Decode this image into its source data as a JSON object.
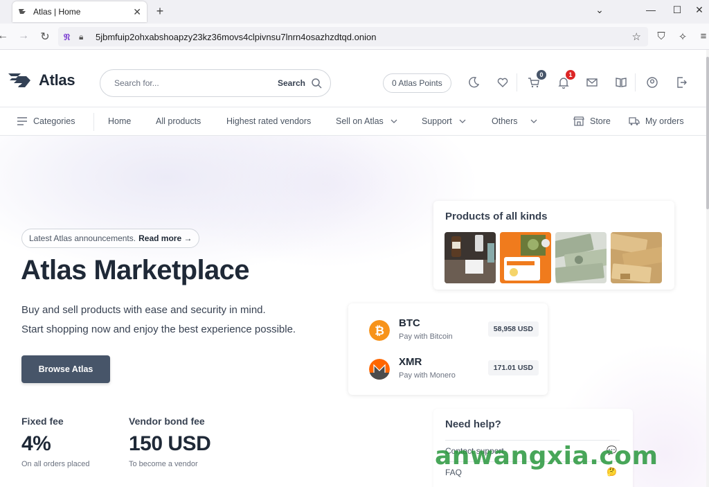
{
  "browser": {
    "tab_title": "Atlas | Home",
    "url": "5jbmfuip2ohxabshoapzy23kz36movs4clpivnsu7lnrn4osazhzdtqd.onion"
  },
  "header": {
    "brand": "Atlas",
    "search_placeholder": "Search for...",
    "search_button": "Search",
    "points": "0 Atlas Points",
    "cart_count": "0",
    "notification_count": "1"
  },
  "nav": {
    "categories": "Categories",
    "home": "Home",
    "all_products": "All products",
    "highest_rated": "Highest rated vendors",
    "sell": "Sell on Atlas",
    "support": "Support",
    "others": "Others",
    "store": "Store",
    "my_orders": "My orders"
  },
  "hero": {
    "announce_text": "Latest Atlas announcements.",
    "announce_link": "Read more →",
    "title": "Atlas Marketplace",
    "sub_line1": "Buy and sell products with ease and security in mind.",
    "sub_line2": "Start shopping now and enjoy the best experience possible.",
    "cta": "Browse Atlas"
  },
  "stats": [
    {
      "label": "Fixed fee",
      "value": "4%",
      "caption": "On all orders placed"
    },
    {
      "label": "Vendor bond fee",
      "value": "150 USD",
      "caption": "To become a vendor"
    }
  ],
  "products_card": {
    "title": "Products of all kinds"
  },
  "crypto": [
    {
      "symbol": "BTC",
      "pay": "Pay with Bitcoin",
      "price": "58,958 USD",
      "color": "#f7931a"
    },
    {
      "symbol": "XMR",
      "pay": "Pay with Monero",
      "price": "171.01 USD",
      "color": "#ff6600"
    }
  ],
  "help": {
    "title": "Need help?",
    "items": [
      "Contact support",
      "FAQ"
    ]
  },
  "watermark": "anwangxia.com",
  "colors": {
    "primary_button": "#475569",
    "badge_cart": "#475569",
    "badge_notify": "#dc2626"
  }
}
